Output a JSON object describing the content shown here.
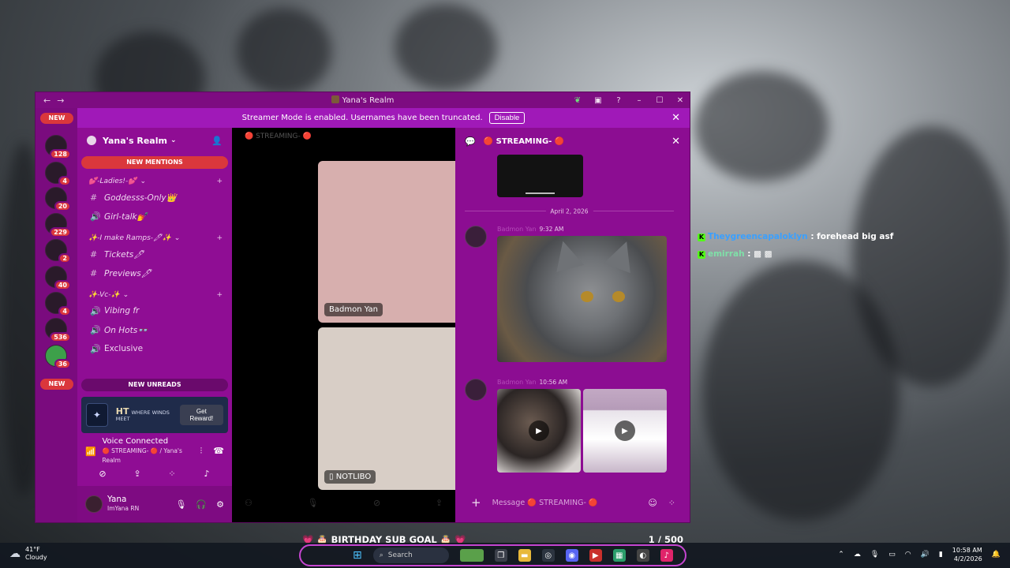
{
  "window": {
    "title": "Yana's Realm",
    "nav_back": "←",
    "nav_forward": "→"
  },
  "banner": {
    "text": "Streamer Mode is enabled. Usernames have been truncated.",
    "disable_label": "Disable"
  },
  "rail": {
    "new_top": "NEW",
    "new_bottom": "NEW",
    "badges": [
      "128",
      "4",
      "20",
      "229",
      "2",
      "40",
      "4",
      "536",
      "36"
    ]
  },
  "sidebar": {
    "server_name": "Yana's Realm",
    "new_mentions": "NEW MENTIONS",
    "new_unreads": "NEW UNREADS",
    "categories": [
      {
        "name": "💕-Ladies!-💕",
        "channels": [
          {
            "icon": "#",
            "name": "Goddesss-Only👑"
          },
          {
            "icon": "🔊",
            "name": "Girl-talk💅"
          }
        ]
      },
      {
        "name": "✨-I make Ramps-🖊✨",
        "channels": [
          {
            "icon": "#",
            "name": "Tickets🖊"
          },
          {
            "icon": "#",
            "name": "Previews🖊"
          }
        ]
      },
      {
        "name": "✨-Vc-✨",
        "channels": [
          {
            "icon": "🔊",
            "name": "Vibing fr"
          },
          {
            "icon": "🔊",
            "name": "On Hots👓"
          },
          {
            "icon": "🔊",
            "name": "Exclusive"
          }
        ]
      }
    ],
    "promo": {
      "logo_text": "HT",
      "text": "WHERE WINDS MEET",
      "button": "Get Reward!"
    },
    "voice": {
      "status": "Voice Connected",
      "location": "🔴 STREAMING- 🔴 / Yana's Realm"
    },
    "user": {
      "name": "Yana",
      "status": "ImYana RN"
    }
  },
  "stage": {
    "header": "🔴 STREAMING- 🔴",
    "tile1_name": "Badmon Yan",
    "tile2_name": "NOTLIBO"
  },
  "chat": {
    "channel": "🔴 STREAMING- 🔴",
    "date_divider": "April 2, 2026",
    "messages": [
      {
        "author": "Badmon Yan",
        "time": "9:32 AM"
      },
      {
        "author": "Badmon Yan",
        "time": "10:56 AM"
      }
    ],
    "composer_placeholder": "Message 🔴 STREAMING- 🔴"
  },
  "overlay": {
    "line1_user": "Theygreencapaloklyn",
    "line1_text": ": forehead big asf",
    "line2_user": "emirrah",
    "line2_text": ":"
  },
  "subgoal": {
    "label": "💗 🎂 BIRTHDAY SUB GOAL 🎂 💗",
    "count": "1 / 500"
  },
  "taskbar": {
    "temp": "41°F",
    "condition": "Cloudy",
    "search_placeholder": "Search",
    "time": "10:58 AM",
    "date": "4/2/2026"
  }
}
